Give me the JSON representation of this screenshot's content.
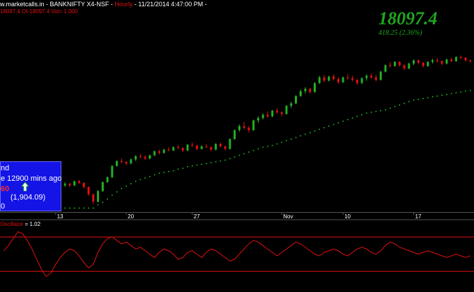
{
  "header": {
    "line1_prefix": "w.marketcalls.in - BANKNIFTY X4-NSF - ",
    "interval": "Hourly",
    "line1_suffix": " - 11/21/2014 4:47:00 PM - ",
    "line2": "18097.4  OI-18097.4  Vol=    1.000"
  },
  "price_display": {
    "value": "18097.4",
    "change": "418.25  (2.36%)"
  },
  "infobox": {
    "line1": "nd",
    "line2": "e 12900 mins ago",
    "line3": "60",
    "line4": "(1,904.09)",
    "line5": "0"
  },
  "oscillator": {
    "label_name": "Oscillator",
    "label_value": " = 1.02"
  },
  "colors": {
    "bull": "#22b022",
    "bear": "#e01010",
    "stop": "#1fc01f",
    "osc": "#e01010",
    "grid": "#555555"
  },
  "chart_data": {
    "type": "candlestick",
    "x_tick_labels": [
      "13",
      "20",
      "27",
      "Nov",
      "10",
      "17"
    ],
    "ylim": [
      15950,
      18450
    ],
    "candles": [
      [
        16080,
        16180,
        16050,
        16150
      ],
      [
        16150,
        16170,
        16110,
        16130
      ],
      [
        16130,
        16260,
        16120,
        16250
      ],
      [
        16250,
        16270,
        16220,
        16240
      ],
      [
        16240,
        16350,
        16230,
        16340
      ],
      [
        16340,
        16400,
        16320,
        16380
      ],
      [
        16380,
        16420,
        16300,
        16320
      ],
      [
        16320,
        16330,
        16200,
        16220
      ],
      [
        16220,
        16240,
        16150,
        16180
      ],
      [
        16180,
        16200,
        16090,
        16110
      ],
      [
        16110,
        16160,
        16040,
        16060
      ],
      [
        16060,
        16250,
        16050,
        16240
      ],
      [
        16240,
        16290,
        16220,
        16270
      ],
      [
        16270,
        16310,
        16250,
        16290
      ],
      [
        16290,
        16300,
        16250,
        16270
      ],
      [
        16270,
        16330,
        16260,
        16320
      ],
      [
        16320,
        16340,
        16290,
        16300
      ],
      [
        16300,
        16310,
        16230,
        16250
      ],
      [
        16250,
        16260,
        16140,
        16160
      ],
      [
        16160,
        16170,
        16040,
        16070
      ],
      [
        16070,
        16210,
        16060,
        16200
      ],
      [
        16200,
        16320,
        16190,
        16310
      ],
      [
        16310,
        16380,
        16300,
        16370
      ],
      [
        16370,
        16520,
        16360,
        16510
      ],
      [
        16510,
        16580,
        16500,
        16570
      ],
      [
        16570,
        16600,
        16540,
        16560
      ],
      [
        16560,
        16570,
        16520,
        16540
      ],
      [
        16540,
        16600,
        16530,
        16590
      ],
      [
        16590,
        16640,
        16570,
        16630
      ],
      [
        16630,
        16660,
        16600,
        16620
      ],
      [
        16620,
        16640,
        16580,
        16600
      ],
      [
        16600,
        16650,
        16590,
        16640
      ],
      [
        16640,
        16700,
        16630,
        16690
      ],
      [
        16690,
        16710,
        16650,
        16670
      ],
      [
        16670,
        16720,
        16660,
        16710
      ],
      [
        16710,
        16740,
        16690,
        16700
      ],
      [
        16700,
        16750,
        16690,
        16740
      ],
      [
        16740,
        16770,
        16720,
        16730
      ],
      [
        16730,
        16740,
        16680,
        16700
      ],
      [
        16700,
        16780,
        16690,
        16770
      ],
      [
        16770,
        16800,
        16740,
        16760
      ],
      [
        16760,
        16770,
        16700,
        16720
      ],
      [
        16720,
        16760,
        16710,
        16750
      ],
      [
        16750,
        16780,
        16730,
        16740
      ],
      [
        16740,
        16750,
        16690,
        16710
      ],
      [
        16710,
        16790,
        16700,
        16780
      ],
      [
        16780,
        16800,
        16740,
        16750
      ],
      [
        16750,
        16760,
        16700,
        16720
      ],
      [
        16720,
        16850,
        16710,
        16840
      ],
      [
        16840,
        16960,
        16830,
        16950
      ],
      [
        16950,
        17020,
        16930,
        17000
      ],
      [
        17000,
        17050,
        16960,
        16980
      ],
      [
        16980,
        17000,
        16920,
        16950
      ],
      [
        16950,
        17080,
        16940,
        17070
      ],
      [
        17070,
        17120,
        17040,
        17100
      ],
      [
        17100,
        17160,
        17080,
        17140
      ],
      [
        17140,
        17180,
        17100,
        17120
      ],
      [
        17120,
        17200,
        17110,
        17190
      ],
      [
        17190,
        17220,
        17150,
        17170
      ],
      [
        17170,
        17180,
        17120,
        17150
      ],
      [
        17150,
        17260,
        17140,
        17250
      ],
      [
        17250,
        17300,
        17220,
        17280
      ],
      [
        17280,
        17380,
        17270,
        17370
      ],
      [
        17370,
        17450,
        17360,
        17430
      ],
      [
        17430,
        17480,
        17400,
        17460
      ],
      [
        17460,
        17470,
        17400,
        17420
      ],
      [
        17420,
        17540,
        17410,
        17530
      ],
      [
        17530,
        17620,
        17520,
        17600
      ],
      [
        17600,
        17630,
        17540,
        17560
      ],
      [
        17560,
        17620,
        17550,
        17610
      ],
      [
        17610,
        17640,
        17560,
        17580
      ],
      [
        17580,
        17600,
        17520,
        17540
      ],
      [
        17540,
        17610,
        17530,
        17600
      ],
      [
        17600,
        17640,
        17570,
        17590
      ],
      [
        17590,
        17620,
        17550,
        17570
      ],
      [
        17570,
        17580,
        17510,
        17530
      ],
      [
        17530,
        17600,
        17520,
        17590
      ],
      [
        17590,
        17640,
        17560,
        17620
      ],
      [
        17620,
        17650,
        17580,
        17600
      ],
      [
        17600,
        17630,
        17550,
        17570
      ],
      [
        17570,
        17680,
        17560,
        17670
      ],
      [
        17670,
        17760,
        17660,
        17750
      ],
      [
        17750,
        17790,
        17720,
        17740
      ],
      [
        17740,
        17800,
        17730,
        17790
      ],
      [
        17790,
        17800,
        17730,
        17750
      ],
      [
        17750,
        17760,
        17690,
        17710
      ],
      [
        17710,
        17780,
        17700,
        17770
      ],
      [
        17770,
        17820,
        17750,
        17810
      ],
      [
        17810,
        17820,
        17760,
        17780
      ],
      [
        17780,
        17790,
        17720,
        17740
      ],
      [
        17740,
        17800,
        17730,
        17790
      ],
      [
        17790,
        17830,
        17770,
        17810
      ],
      [
        17810,
        17840,
        17780,
        17800
      ],
      [
        17800,
        17810,
        17750,
        17770
      ],
      [
        17770,
        17830,
        17760,
        17820
      ],
      [
        17820,
        17840,
        17790,
        17800
      ],
      [
        17800,
        17860,
        17790,
        17850
      ],
      [
        17850,
        17870,
        17820,
        17840
      ],
      [
        17840,
        17850,
        17790,
        17810
      ],
      [
        17810,
        17820,
        17780,
        17800
      ]
    ],
    "trailing_stop": [
      15990,
      15990,
      15990,
      15990,
      15990,
      15990,
      15990,
      15990,
      15990,
      15990,
      15990,
      15990,
      15990,
      15990,
      15990,
      15990,
      15990,
      15990,
      15990,
      15990,
      16030,
      16060,
      16100,
      16150,
      16190,
      16230,
      16260,
      16290,
      16320,
      16340,
      16360,
      16380,
      16400,
      16420,
      16430,
      16440,
      16450,
      16470,
      16480,
      16500,
      16510,
      16520,
      16530,
      16540,
      16550,
      16560,
      16570,
      16580,
      16600,
      16620,
      16640,
      16660,
      16680,
      16700,
      16720,
      16740,
      16750,
      16760,
      16780,
      16800,
      16820,
      16840,
      16860,
      16880,
      16900,
      16920,
      16940,
      16960,
      16980,
      17000,
      17020,
      17040,
      17060,
      17080,
      17100,
      17120,
      17140,
      17160,
      17170,
      17180,
      17190,
      17200,
      17220,
      17240,
      17260,
      17280,
      17300,
      17320,
      17330,
      17340,
      17350,
      17360,
      17370,
      17380,
      17390,
      17400,
      17410,
      17420,
      17430,
      17440
    ],
    "oscillator": {
      "ylim": [
        -1.6,
        1.6
      ],
      "upper_band": 1.0,
      "lower_band": -1.0,
      "values": [
        0.2,
        0.5,
        0.9,
        1.3,
        1.2,
        0.8,
        0.3,
        -0.3,
        -0.9,
        -1.3,
        -1.1,
        -0.6,
        -0.2,
        0.1,
        0.3,
        0.2,
        -0.1,
        -0.5,
        -0.8,
        -0.6,
        0.1,
        0.6,
        0.9,
        1.0,
        0.8,
        0.6,
        0.7,
        0.5,
        0.3,
        0.4,
        0.2,
        0.0,
        -0.2,
        0.1,
        0.3,
        0.2,
        0.0,
        -0.3,
        -0.2,
        0.1,
        0.2,
        0.0,
        -0.2,
        0.1,
        0.3,
        0.2,
        0.0,
        -0.2,
        -0.4,
        -0.3,
        0.0,
        0.3,
        0.6,
        0.8,
        0.7,
        0.5,
        0.3,
        0.1,
        -0.1,
        0.1,
        0.3,
        0.5,
        0.7,
        0.6,
        0.4,
        0.2,
        0.0,
        -0.1,
        0.1,
        0.2,
        0.3,
        0.2,
        0.0,
        -0.1,
        0.1,
        0.3,
        0.4,
        0.3,
        0.1,
        0.0,
        0.2,
        0.5,
        0.7,
        0.6,
        0.4,
        0.3,
        0.2,
        0.1,
        0.0,
        0.1,
        0.2,
        0.1,
        0.0,
        -0.1,
        -0.2,
        -0.1,
        0.0,
        -0.1,
        -0.2,
        -0.1
      ]
    }
  }
}
